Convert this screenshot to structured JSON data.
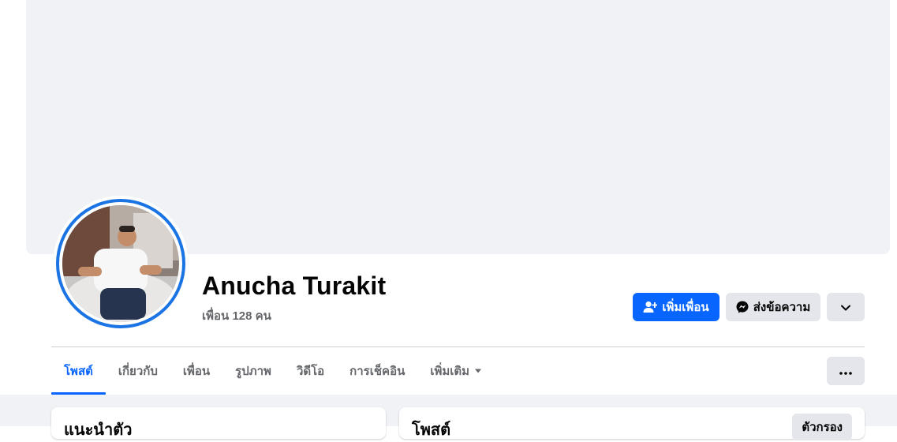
{
  "profile": {
    "name": "Anucha Turakit",
    "friends_count": "เพื่อน 128 คน"
  },
  "actions": {
    "add_friend": "เพิ่มเพื่อน",
    "message": "ส่งข้อความ"
  },
  "tabs": [
    {
      "label": "โพสต์",
      "active": true
    },
    {
      "label": "เกี่ยวกับ"
    },
    {
      "label": "เพื่อน"
    },
    {
      "label": "รูปภาพ"
    },
    {
      "label": "วิดีโอ"
    },
    {
      "label": "การเช็คอิน"
    },
    {
      "label": "เพิ่มเติม"
    }
  ],
  "cards": {
    "intro_title": "แนะนำตัว",
    "posts_title": "โพสต์",
    "filter_label": "ตัวกรอง"
  },
  "colors": {
    "accent": "#0866ff",
    "cover": "#f0f2f5",
    "secondary_button": "#e4e6eb"
  },
  "icons": {
    "add_friend": "person-add-icon",
    "message": "messenger-icon",
    "more": "chevron-down-icon",
    "tab_more": "caret-down-icon",
    "options": "ellipsis-icon"
  }
}
